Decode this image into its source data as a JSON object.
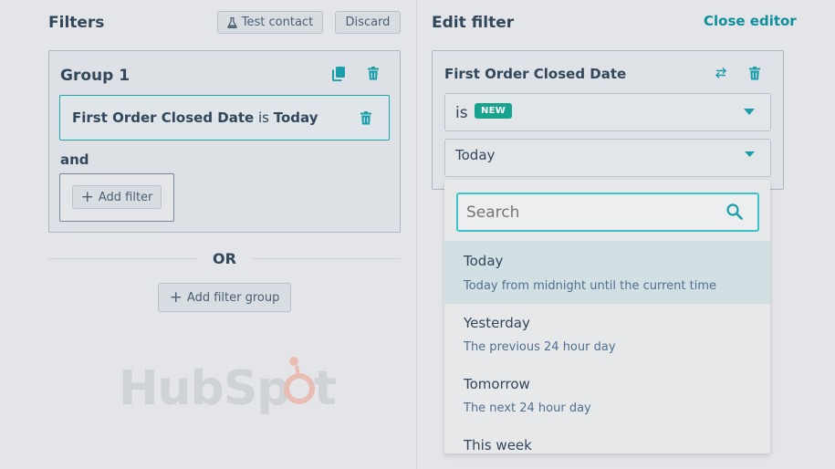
{
  "filters": {
    "title": "Filters",
    "test_contact_label": "Test contact",
    "discard_label": "Discard",
    "group": {
      "title": "Group 1",
      "rule": {
        "property": "First Order Closed Date",
        "operator": "is",
        "value": "Today"
      },
      "and_label": "and",
      "add_filter_label": "Add filter"
    },
    "or_label": "OR",
    "add_filter_group_label": "Add filter group"
  },
  "editor": {
    "title": "Edit filter",
    "close_label": "Close editor",
    "property_name": "First Order Closed Date",
    "operator_value": "is",
    "new_badge": "NEW",
    "date_value": "Today",
    "search_placeholder": "Search",
    "options": [
      {
        "label": "Today",
        "description": "Today from midnight until the current time",
        "selected": true
      },
      {
        "label": "Yesterday",
        "description": "The previous 24 hour day",
        "selected": false
      },
      {
        "label": "Tomorrow",
        "description": "The next 24 hour day",
        "selected": false
      },
      {
        "label": "This week",
        "description": "",
        "selected": false
      }
    ]
  },
  "watermark": {
    "text": "HubSpot"
  },
  "colors": {
    "accent": "#19a5ad",
    "link": "#0f8f9c",
    "new_badge": "#18a38f",
    "selected_option_bg": "#d2e0e4",
    "text": "#33475b"
  }
}
